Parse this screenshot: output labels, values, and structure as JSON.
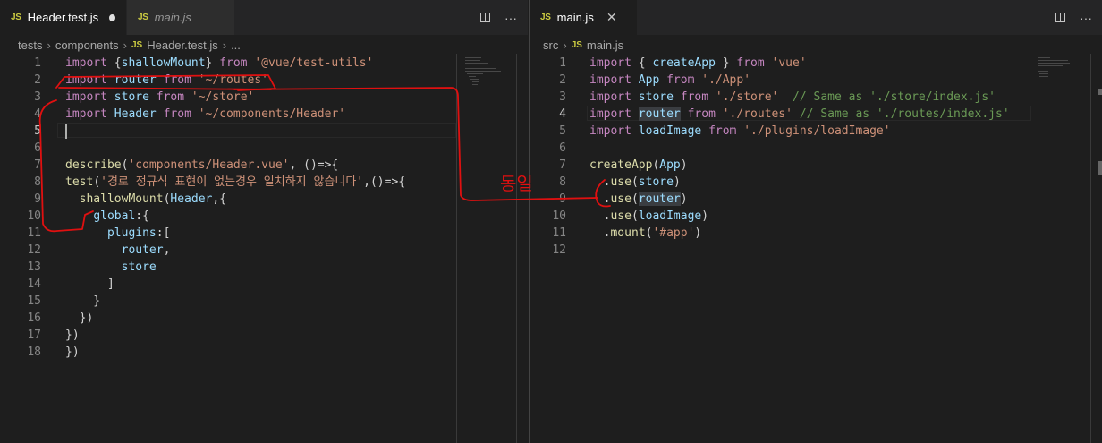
{
  "left": {
    "tabs": [
      {
        "icon": "JS",
        "label": "Header.test.js",
        "modified": true
      },
      {
        "icon": "JS",
        "label": "main.js"
      }
    ],
    "actions": {
      "more": "···"
    },
    "breadcrumb": [
      "tests",
      "components",
      "Header.test.js",
      "..."
    ],
    "breadcrumb_icon": "JS",
    "lines": [
      {
        "n": "1",
        "tokens": [
          [
            "kw",
            "import"
          ],
          [
            "pu",
            " {"
          ],
          [
            "id",
            "shallowMount"
          ],
          [
            "pu",
            "} "
          ],
          [
            "kw",
            "from"
          ],
          [
            "pu",
            " "
          ],
          [
            "st",
            "'@vue/test-utils'"
          ]
        ]
      },
      {
        "n": "2",
        "tokens": [
          [
            "kw",
            "import"
          ],
          [
            "pu",
            " "
          ],
          [
            "id",
            "router"
          ],
          [
            "pu",
            " "
          ],
          [
            "kw",
            "from"
          ],
          [
            "pu",
            " "
          ],
          [
            "st",
            "'~/routes'"
          ]
        ]
      },
      {
        "n": "3",
        "tokens": [
          [
            "kw",
            "import"
          ],
          [
            "pu",
            " "
          ],
          [
            "id",
            "store"
          ],
          [
            "pu",
            " "
          ],
          [
            "kw",
            "from"
          ],
          [
            "pu",
            " "
          ],
          [
            "st",
            "'~/store'"
          ]
        ]
      },
      {
        "n": "4",
        "tokens": [
          [
            "kw",
            "import"
          ],
          [
            "pu",
            " "
          ],
          [
            "id",
            "Header"
          ],
          [
            "pu",
            " "
          ],
          [
            "kw",
            "from"
          ],
          [
            "pu",
            " "
          ],
          [
            "st",
            "'~/components/Header'"
          ]
        ]
      },
      {
        "n": "5",
        "tokens": []
      },
      {
        "n": "6",
        "tokens": []
      },
      {
        "n": "7",
        "tokens": [
          [
            "fn",
            "describe"
          ],
          [
            "pu",
            "("
          ],
          [
            "st",
            "'components/Header.vue'"
          ],
          [
            "pu",
            ", ()=>{"
          ]
        ]
      },
      {
        "n": "8",
        "tokens": [
          [
            "fn",
            "test"
          ],
          [
            "pu",
            "("
          ],
          [
            "st",
            "'경로 정규식 표현이 없는경우 일치하지 않습니다'"
          ],
          [
            "pu",
            ",()=>{"
          ]
        ]
      },
      {
        "n": "9",
        "tokens": [
          [
            "pu",
            "  "
          ],
          [
            "fn",
            "shallowMount"
          ],
          [
            "pu",
            "("
          ],
          [
            "id",
            "Header"
          ],
          [
            "pu",
            ",{"
          ]
        ]
      },
      {
        "n": "10",
        "tokens": [
          [
            "pu",
            "    "
          ],
          [
            "id",
            "global"
          ],
          [
            "pu",
            ":{"
          ]
        ]
      },
      {
        "n": "11",
        "tokens": [
          [
            "pu",
            "      "
          ],
          [
            "id",
            "plugins"
          ],
          [
            "pu",
            ":["
          ]
        ]
      },
      {
        "n": "12",
        "tokens": [
          [
            "pu",
            "        "
          ],
          [
            "id",
            "router"
          ],
          [
            "pu",
            ","
          ]
        ]
      },
      {
        "n": "13",
        "tokens": [
          [
            "pu",
            "        "
          ],
          [
            "id",
            "store"
          ]
        ]
      },
      {
        "n": "14",
        "tokens": [
          [
            "pu",
            "      ]"
          ]
        ]
      },
      {
        "n": "15",
        "tokens": [
          [
            "pu",
            "    }"
          ]
        ]
      },
      {
        "n": "16",
        "tokens": [
          [
            "pu",
            "  })"
          ]
        ]
      },
      {
        "n": "17",
        "tokens": [
          [
            "pu",
            "})"
          ]
        ]
      },
      {
        "n": "18",
        "tokens": [
          [
            "pu",
            "})"
          ]
        ]
      }
    ],
    "current_line": "5"
  },
  "right": {
    "tabs": [
      {
        "icon": "JS",
        "label": "main.js",
        "close": "✕"
      }
    ],
    "actions": {
      "more": "···"
    },
    "breadcrumb": [
      "src",
      "main.js"
    ],
    "breadcrumb_icon": "JS",
    "lines": [
      {
        "n": "1",
        "tokens": [
          [
            "kw",
            "import"
          ],
          [
            "pu",
            " { "
          ],
          [
            "id",
            "createApp"
          ],
          [
            "pu",
            " } "
          ],
          [
            "kw",
            "from"
          ],
          [
            "pu",
            " "
          ],
          [
            "st",
            "'vue'"
          ]
        ]
      },
      {
        "n": "2",
        "tokens": [
          [
            "kw",
            "import"
          ],
          [
            "pu",
            " "
          ],
          [
            "id",
            "App"
          ],
          [
            "pu",
            " "
          ],
          [
            "kw",
            "from"
          ],
          [
            "pu",
            " "
          ],
          [
            "st",
            "'./App'"
          ]
        ]
      },
      {
        "n": "3",
        "tokens": [
          [
            "kw",
            "import"
          ],
          [
            "pu",
            " "
          ],
          [
            "id",
            "store"
          ],
          [
            "pu",
            " "
          ],
          [
            "kw",
            "from"
          ],
          [
            "pu",
            " "
          ],
          [
            "st",
            "'./store'"
          ],
          [
            "pu",
            "  "
          ],
          [
            "cm",
            "// Same as './store/index.js'"
          ]
        ]
      },
      {
        "n": "4",
        "tokens": [
          [
            "kw",
            "import"
          ],
          [
            "pu",
            " "
          ],
          [
            "id",
            "router",
            "hl"
          ],
          [
            "pu",
            " "
          ],
          [
            "kw",
            "from"
          ],
          [
            "pu",
            " "
          ],
          [
            "st",
            "'./routes'"
          ],
          [
            "pu",
            " "
          ],
          [
            "cm",
            "// Same as './routes/index.js'"
          ]
        ]
      },
      {
        "n": "5",
        "tokens": [
          [
            "kw",
            "import"
          ],
          [
            "pu",
            " "
          ],
          [
            "id",
            "loadImage"
          ],
          [
            "pu",
            " "
          ],
          [
            "kw",
            "from"
          ],
          [
            "pu",
            " "
          ],
          [
            "st",
            "'./plugins/loadImage'"
          ]
        ]
      },
      {
        "n": "6",
        "tokens": []
      },
      {
        "n": "7",
        "tokens": [
          [
            "fn",
            "createApp"
          ],
          [
            "pu",
            "("
          ],
          [
            "id",
            "App"
          ],
          [
            "pu",
            ")"
          ]
        ]
      },
      {
        "n": "8",
        "tokens": [
          [
            "pu",
            "  ."
          ],
          [
            "fn",
            "use"
          ],
          [
            "pu",
            "("
          ],
          [
            "id",
            "store"
          ],
          [
            "pu",
            ")"
          ]
        ]
      },
      {
        "n": "9",
        "tokens": [
          [
            "pu",
            "  ."
          ],
          [
            "fn",
            "use"
          ],
          [
            "pu",
            "("
          ],
          [
            "id",
            "router",
            "hl"
          ],
          [
            "pu",
            ")"
          ]
        ]
      },
      {
        "n": "10",
        "tokens": [
          [
            "pu",
            "  ."
          ],
          [
            "fn",
            "use"
          ],
          [
            "pu",
            "("
          ],
          [
            "id",
            "loadImage"
          ],
          [
            "pu",
            ")"
          ]
        ]
      },
      {
        "n": "11",
        "tokens": [
          [
            "pu",
            "  ."
          ],
          [
            "fn",
            "mount"
          ],
          [
            "pu",
            "("
          ],
          [
            "st",
            "'#app'"
          ],
          [
            "pu",
            ")"
          ]
        ]
      },
      {
        "n": "12",
        "tokens": []
      }
    ],
    "current_line": "4"
  },
  "annotation": {
    "text": "동일",
    "color": "#e01010"
  },
  "colors": {
    "keyword": "#c586c0",
    "identifier": "#9cdcfe",
    "string": "#ce9178",
    "function": "#dcdcaa",
    "comment": "#6a9955"
  }
}
